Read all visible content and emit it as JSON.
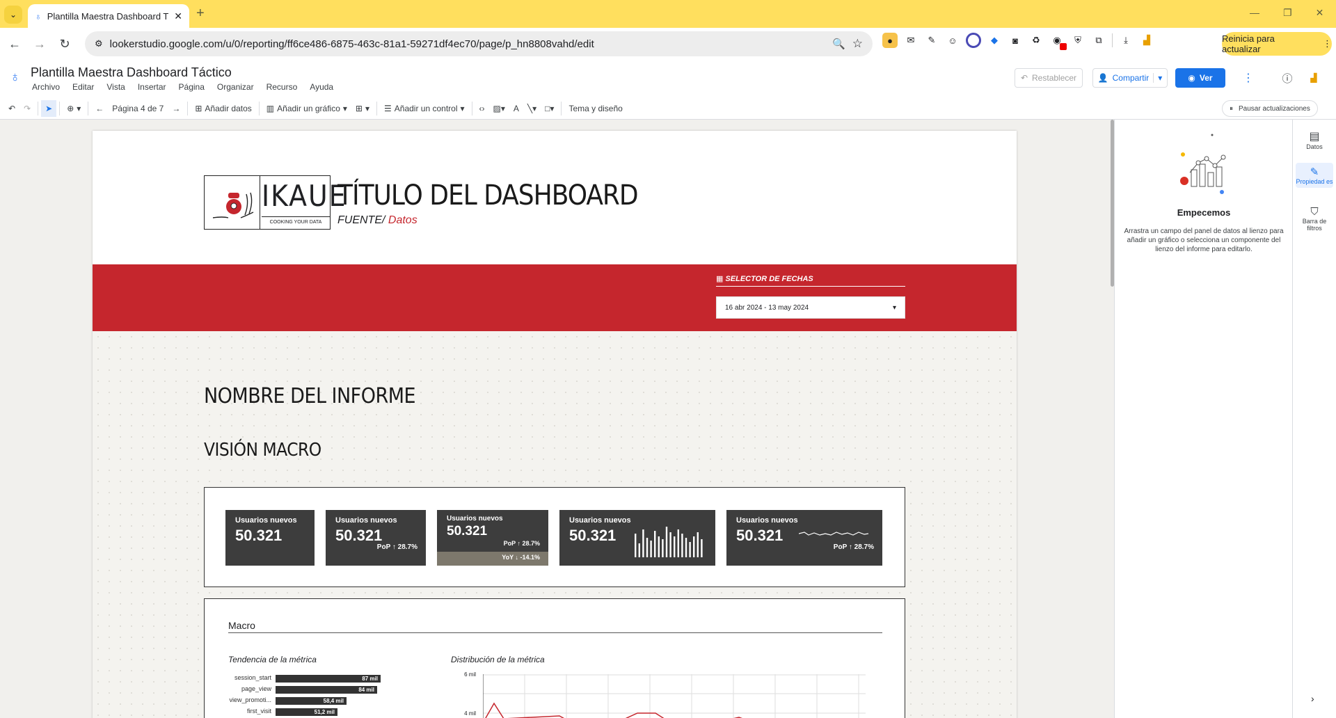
{
  "browser": {
    "tab_title": "Plantilla Maestra Dashboard Tá",
    "url": "lookerstudio.google.com/u/0/reporting/ff6ce486-6875-463c-81a1-59271df4ec70/page/p_hn8808vahd/edit",
    "relaunch_label": "Reinicia para actualizar"
  },
  "app": {
    "title": "Plantilla Maestra Dashboard Táctico",
    "menus": [
      "Archivo",
      "Editar",
      "Vista",
      "Insertar",
      "Página",
      "Organizar",
      "Recurso",
      "Ayuda"
    ],
    "reset_label": "Restablecer",
    "share_label": "Compartir",
    "view_label": "Ver"
  },
  "toolbar": {
    "page_label": "Página 4 de 7",
    "add_data": "Añadir datos",
    "add_chart": "Añadir un gráfico",
    "add_control": "Añadir un control",
    "theme": "Tema y diseño",
    "pause": "Pausar actualizaciones"
  },
  "report": {
    "logo_text": "IKAUE",
    "logo_sub": "COOKING YOUR DATA",
    "title": "TÍTULO DEL DASHBOARD",
    "source_label": "FUENTE/",
    "source_value": " Datos",
    "date_selector_label": "SELECTOR DE FECHAS",
    "date_range": "16 abr 2024 - 13 may 2024",
    "report_name": "NOMBRE DEL INFORME",
    "section": "VISIÓN MACRO",
    "kpis": [
      {
        "label": "Usuarios nuevos",
        "value": "50.321"
      },
      {
        "label": "Usuarios nuevos",
        "value": "50.321",
        "pop": "PoP",
        "pop_value": "↑ 28.7%"
      },
      {
        "label": "Usuarios nuevos",
        "value": "50.321",
        "pop": "PoP",
        "pop_value": "↑ 28.7%",
        "yoy": "YoY",
        "yoy_value": "↓ -14.1%"
      },
      {
        "label": "Usuarios nuevos",
        "value": "50.321"
      },
      {
        "label": "Usuarios nuevos",
        "value": "50.321",
        "pop": "PoP",
        "pop_value": "↑ 28.7%"
      }
    ],
    "macro_label": "Macro",
    "trend_title": "Tendencia de la métrica",
    "dist_title": "Distribución de la métrica",
    "bars": [
      {
        "label": "session_start",
        "value": "87 mil",
        "v": 87
      },
      {
        "label": "page_view",
        "value": "84 mil",
        "v": 84
      },
      {
        "label": "view_promoti...",
        "value": "58,4 mil",
        "v": 58.4
      },
      {
        "label": "first_visit",
        "value": "51,2 mil",
        "v": 51.2
      }
    ],
    "dist_ticks": [
      "6 mil",
      "4 mil"
    ]
  },
  "panel": {
    "title": "Empecemos",
    "description": "Arrastra un campo del panel de datos al lienzo para añadir un gráfico o selecciona un componente del lienzo del informe para editarlo."
  },
  "rail": {
    "data": "Datos",
    "properties": "Propiedad es",
    "filter_bar": "Barra de filtros"
  },
  "colors": {
    "accent_red": "#c5262d",
    "kpi_bg": "#3d3d3d",
    "chrome_yellow": "#ffdf5e",
    "primary_blue": "#1a73e8"
  }
}
